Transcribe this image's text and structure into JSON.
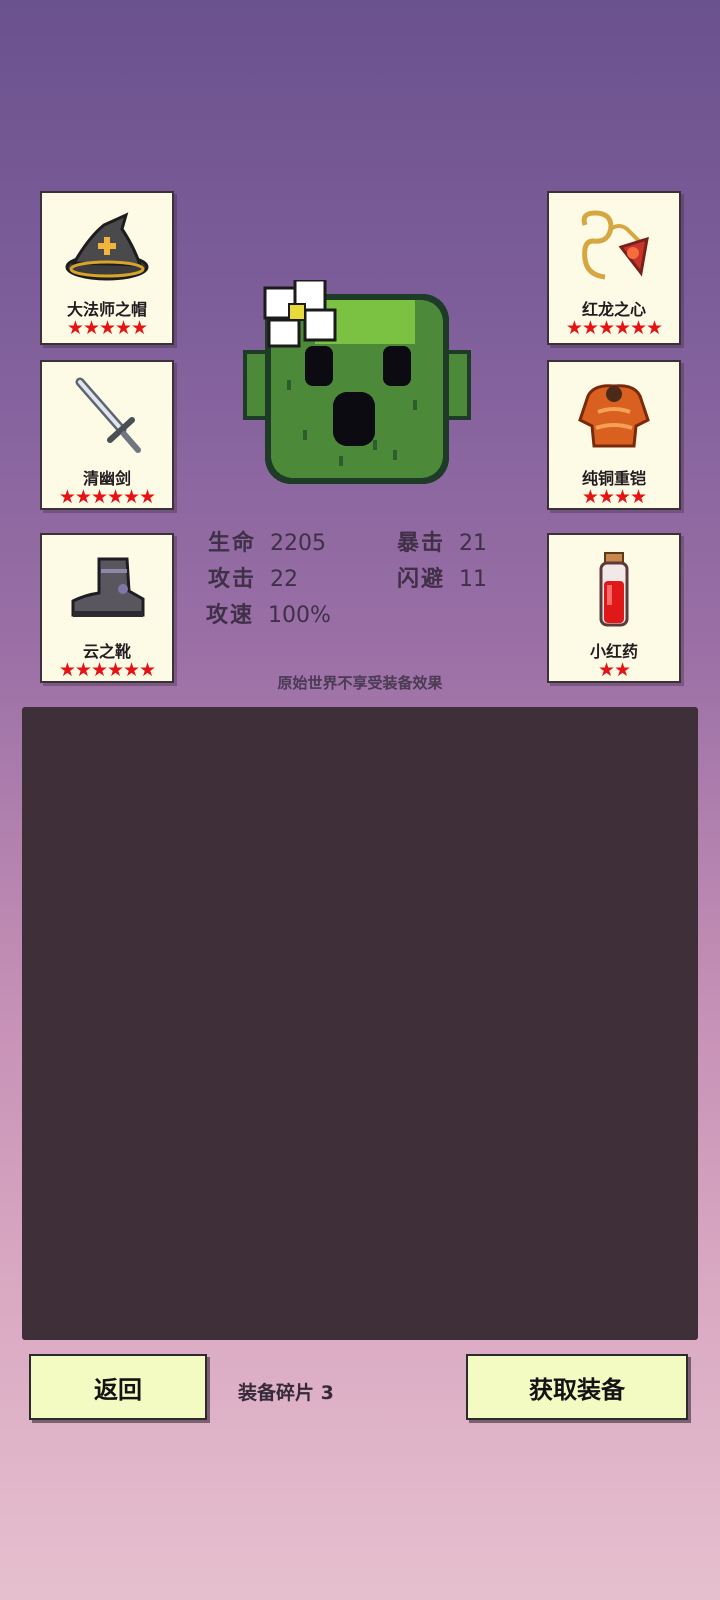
{
  "equipment_left": [
    {
      "name": "大法师之帽",
      "stars": "★★★★★",
      "icon": "wizard-hat-icon"
    },
    {
      "name": "清幽剑",
      "stars": "★★★★★★",
      "icon": "sword-icon"
    },
    {
      "name": "云之靴",
      "stars": "★★★★★★",
      "icon": "boot-icon"
    }
  ],
  "equipment_right": [
    {
      "name": "红龙之心",
      "stars": "★★★★★★",
      "icon": "amulet-icon"
    },
    {
      "name": "纯铜重铠",
      "stars": "★★★★",
      "icon": "armor-icon"
    },
    {
      "name": "小红药",
      "stars": "★★",
      "icon": "potion-icon"
    }
  ],
  "stats": {
    "hp_label": "生命",
    "hp_value": "2205",
    "atk_label": "攻击",
    "atk_value": "22",
    "spd_label": "攻速",
    "spd_value": "100%",
    "crit_label": "暴击",
    "crit_value": "21",
    "dodge_label": "闪避",
    "dodge_value": "11"
  },
  "note": "原始世界不享受装备效果",
  "footer": {
    "back_label": "返回",
    "fragments_label": "装备碎片 3",
    "get_equipment_label": "获取装备"
  },
  "colors": {
    "star": "#e41414",
    "card_bg": "#fdfbe6",
    "button_bg": "#f4fbc2",
    "panel_bg": "#3f2f38"
  }
}
